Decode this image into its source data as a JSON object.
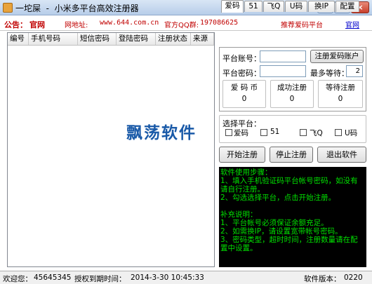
{
  "window": {
    "title": "一坨屎  -  小米多平台高效注册器",
    "controls": {
      "minimize": "–",
      "maximize": "□",
      "close": "×"
    }
  },
  "notice": {
    "label": "公告：",
    "official": "官网",
    "url_label": "网地址:",
    "url": "www.644.com.cn",
    "qq_label": "官方QQ群:",
    "qq": "197086625",
    "recommend": "推荐爱码平台",
    "recommend_link": "官网"
  },
  "table": {
    "columns": [
      "编号",
      "手机号码",
      "短信密码",
      "登陆密码",
      "注册状态",
      "来源"
    ],
    "rows": []
  },
  "tabs": [
    "爱码",
    "51",
    "飞Q",
    "U码",
    "换IP",
    "配置"
  ],
  "active_tab": "爱码",
  "platform_form": {
    "account_label": "平台账号：",
    "account_value": "",
    "password_label": "平台密码：",
    "password_value": "",
    "register_button": "注册爱码账户",
    "max_wait_label": "最多等待：",
    "max_wait_value": "2"
  },
  "stats": [
    {
      "label": "爱  码  币",
      "value": "0"
    },
    {
      "label": "成功注册",
      "value": "0"
    },
    {
      "label": "等待注册",
      "value": "0"
    }
  ],
  "platform_select": {
    "title": "选择平台：",
    "options": [
      {
        "label": "爱码",
        "checked": true
      },
      {
        "label": "51",
        "checked": false
      },
      {
        "label": "飞Q",
        "checked": false
      },
      {
        "label": "U码",
        "checked": false
      }
    ]
  },
  "actions": {
    "start": "开始注册",
    "stop": "停止注册",
    "exit": "退出软件"
  },
  "console": {
    "lines": [
      "软件使用步骤：",
      "1、填入手机验证码平台帐号密码，如没有请自行注册。",
      "2、勾选选择平台，点击开始注册。",
      "",
      "补充说明：",
      "1、平台帐号必须保证余额充足。",
      "2、如需换IP，请设置宽带帐号密码。",
      "3、密码类型，超时时间，注册数量请在配置中设置。"
    ],
    "text_color": "#00e000",
    "background": "#000000"
  },
  "watermark": "飘荡软件",
  "statusbar": {
    "welcome_label": "欢迎您：",
    "user_id": "45645345",
    "auth_label": "授权到期时间：",
    "auth_value": "2014-3-30  10:45:33",
    "version_label": "软件版本：",
    "version_value": "0220"
  }
}
